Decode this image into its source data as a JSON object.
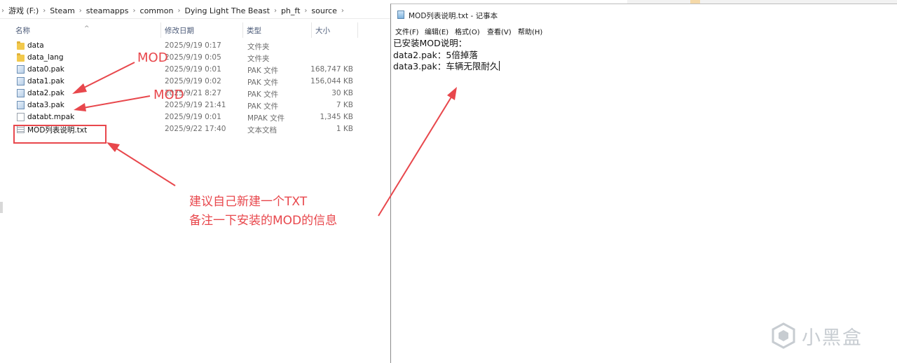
{
  "explorer": {
    "breadcrumb": [
      "游戏 (F:)",
      "Steam",
      "steamapps",
      "common",
      "Dying Light The Beast",
      "ph_ft",
      "source"
    ],
    "columns": {
      "name": "名称",
      "date": "修改日期",
      "type": "类型",
      "size": "大小"
    },
    "files": [
      {
        "name": "data",
        "date": "2025/9/19 0:17",
        "type": "文件夹",
        "size": "",
        "icon": "folder-icon"
      },
      {
        "name": "data_lang",
        "date": "2025/9/19 0:05",
        "type": "文件夹",
        "size": "",
        "icon": "folder-icon"
      },
      {
        "name": "data0.pak",
        "date": "2025/9/19 0:01",
        "type": "PAK 文件",
        "size": "168,747 KB",
        "icon": "pak-file-icon"
      },
      {
        "name": "data1.pak",
        "date": "2025/9/19 0:02",
        "type": "PAK 文件",
        "size": "156,044 KB",
        "icon": "pak-file-icon"
      },
      {
        "name": "data2.pak",
        "date": "2025/9/21 8:27",
        "type": "PAK 文件",
        "size": "30 KB",
        "icon": "pak-file-icon"
      },
      {
        "name": "data3.pak",
        "date": "2025/9/19 21:41",
        "type": "PAK 文件",
        "size": "7 KB",
        "icon": "pak-file-icon"
      },
      {
        "name": "databt.mpak",
        "date": "2025/9/19 0:01",
        "type": "MPAK 文件",
        "size": "1,345 KB",
        "icon": "generic-file-icon"
      },
      {
        "name": "MOD列表说明.txt",
        "date": "2025/9/22 17:40",
        "type": "文本文档",
        "size": "1 KB",
        "icon": "text-file-icon"
      }
    ]
  },
  "notepad": {
    "title": "MOD列表说明.txt - 记事本",
    "menu": [
      "文件(F)",
      "编辑(E)",
      "格式(O)",
      "查看(V)",
      "帮助(H)"
    ],
    "lines": [
      "已安装MOD说明：",
      "data2.pak：5倍掉落",
      "data3.pak：车辆无限耐久"
    ]
  },
  "annotations": {
    "mod_label_1": "MOD",
    "mod_label_2": "MOD",
    "note_line_1": "建议自己新建一个TXT",
    "note_line_2": "备注一下安装的MOD的信息",
    "color": "#e8474c"
  },
  "watermark": {
    "text": "小黑盒"
  }
}
